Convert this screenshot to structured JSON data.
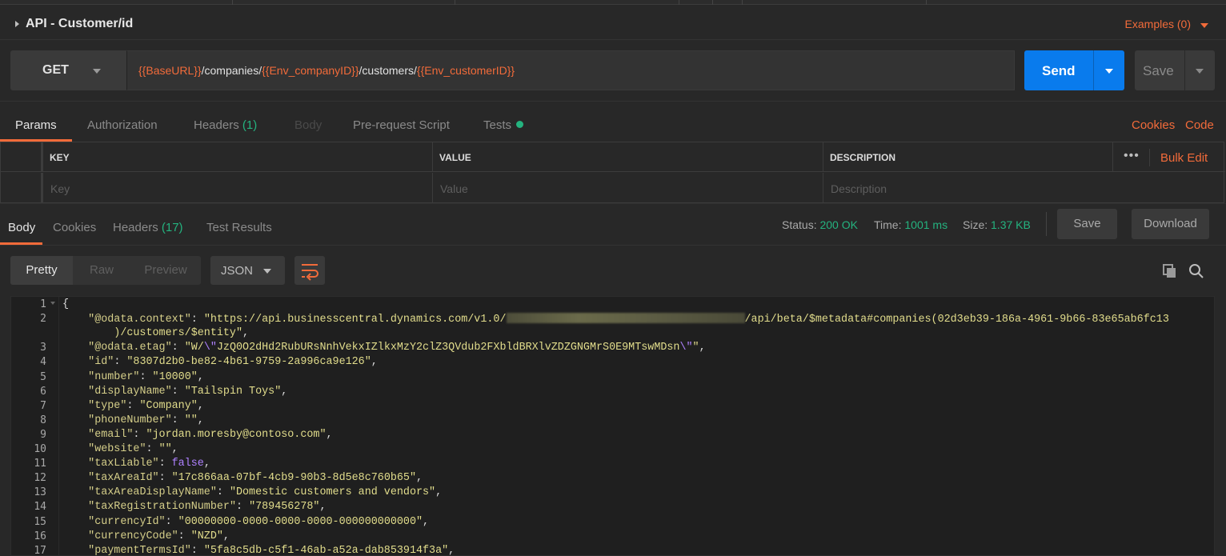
{
  "request": {
    "title": "API - Customer/id",
    "examples_label": "Examples (0)",
    "method": "GET",
    "url_parts": [
      {
        "text": "{{BaseURL}}",
        "type": "var"
      },
      {
        "text": "/companies/",
        "type": "path"
      },
      {
        "text": "{{Env_companyID}}",
        "type": "var"
      },
      {
        "text": "/customers/",
        "type": "path"
      },
      {
        "text": "{{Env_customerID}}",
        "type": "var"
      }
    ],
    "send_label": "Send",
    "save_label": "Save"
  },
  "request_tabs": {
    "params": "Params",
    "authorization": "Authorization",
    "headers": "Headers",
    "headers_count": "(1)",
    "body": "Body",
    "prerequest": "Pre-request Script",
    "tests": "Tests",
    "cookies_link": "Cookies",
    "code_link": "Code"
  },
  "params_table": {
    "headers": [
      "KEY",
      "VALUE",
      "DESCRIPTION"
    ],
    "placeholders": [
      "Key",
      "Value",
      "Description"
    ],
    "more": "•••",
    "bulk_edit": "Bulk Edit"
  },
  "response": {
    "tabs": {
      "body": "Body",
      "cookies": "Cookies",
      "headers": "Headers",
      "headers_count": "(17)",
      "test_results": "Test Results"
    },
    "status_label": "Status:",
    "status_value": "200 OK",
    "time_label": "Time:",
    "time_value": "1001 ms",
    "size_label": "Size:",
    "size_value": "1.37 KB",
    "save_label": "Save",
    "download_label": "Download",
    "view_modes": [
      "Pretty",
      "Raw",
      "Preview"
    ],
    "active_view": "Pretty",
    "format": "JSON"
  },
  "code_lines": [
    {
      "n": "1",
      "segs": [
        [
          "pun",
          "{"
        ]
      ]
    },
    {
      "n": "2",
      "segs": [
        [
          "pun",
          "    "
        ],
        [
          "key",
          "\"@odata.context\""
        ],
        [
          "pun",
          ": "
        ],
        [
          "str",
          "\"https://api.businesscentral.dynamics.com/v1.0/"
        ],
        [
          "blur",
          ""
        ],
        [
          "str",
          "/api/beta/$metadata#companies(02d3eb39-186a-4961-9b66-83e65ab6fc13"
        ]
      ]
    },
    {
      "n": "",
      "segs": [
        [
          "str",
          "        )/customers/$entity\""
        ],
        [
          "pun",
          ","
        ]
      ]
    },
    {
      "n": "3",
      "segs": [
        [
          "pun",
          "    "
        ],
        [
          "key",
          "\"@odata.etag\""
        ],
        [
          "pun",
          ": "
        ],
        [
          "str",
          "\"W/"
        ],
        [
          "esc",
          "\\\""
        ],
        [
          "str",
          "JzQ0O2dHd2RubURsNnhVekxIZlkxMzY2clZ3QVdub2FXbldBRXlvZDZGNGMrS0E9MTswMDsn"
        ],
        [
          "esc",
          "\\\""
        ],
        [
          "str",
          "\""
        ],
        [
          "pun",
          ","
        ]
      ]
    },
    {
      "n": "4",
      "segs": [
        [
          "pun",
          "    "
        ],
        [
          "key",
          "\"id\""
        ],
        [
          "pun",
          ": "
        ],
        [
          "str",
          "\"8307d2b0-be82-4b61-9759-2a996ca9e126\""
        ],
        [
          "pun",
          ","
        ]
      ]
    },
    {
      "n": "5",
      "segs": [
        [
          "pun",
          "    "
        ],
        [
          "key",
          "\"number\""
        ],
        [
          "pun",
          ": "
        ],
        [
          "str",
          "\"10000\""
        ],
        [
          "pun",
          ","
        ]
      ]
    },
    {
      "n": "6",
      "segs": [
        [
          "pun",
          "    "
        ],
        [
          "key",
          "\"displayName\""
        ],
        [
          "pun",
          ": "
        ],
        [
          "str",
          "\"Tailspin Toys\""
        ],
        [
          "pun",
          ","
        ]
      ]
    },
    {
      "n": "7",
      "segs": [
        [
          "pun",
          "    "
        ],
        [
          "key",
          "\"type\""
        ],
        [
          "pun",
          ": "
        ],
        [
          "str",
          "\"Company\""
        ],
        [
          "pun",
          ","
        ]
      ]
    },
    {
      "n": "8",
      "segs": [
        [
          "pun",
          "    "
        ],
        [
          "key",
          "\"phoneNumber\""
        ],
        [
          "pun",
          ": "
        ],
        [
          "str",
          "\"\""
        ],
        [
          "pun",
          ","
        ]
      ]
    },
    {
      "n": "9",
      "segs": [
        [
          "pun",
          "    "
        ],
        [
          "key",
          "\"email\""
        ],
        [
          "pun",
          ": "
        ],
        [
          "str",
          "\"jordan.moresby@contoso.com\""
        ],
        [
          "pun",
          ","
        ]
      ]
    },
    {
      "n": "10",
      "segs": [
        [
          "pun",
          "    "
        ],
        [
          "key",
          "\"website\""
        ],
        [
          "pun",
          ": "
        ],
        [
          "str",
          "\"\""
        ],
        [
          "pun",
          ","
        ]
      ]
    },
    {
      "n": "11",
      "segs": [
        [
          "pun",
          "    "
        ],
        [
          "key",
          "\"taxLiable\""
        ],
        [
          "pun",
          ": "
        ],
        [
          "bool",
          "false"
        ],
        [
          "pun",
          ","
        ]
      ]
    },
    {
      "n": "12",
      "segs": [
        [
          "pun",
          "    "
        ],
        [
          "key",
          "\"taxAreaId\""
        ],
        [
          "pun",
          ": "
        ],
        [
          "str",
          "\"17c866aa-07bf-4cb9-90b3-8d5e8c760b65\""
        ],
        [
          "pun",
          ","
        ]
      ]
    },
    {
      "n": "13",
      "segs": [
        [
          "pun",
          "    "
        ],
        [
          "key",
          "\"taxAreaDisplayName\""
        ],
        [
          "pun",
          ": "
        ],
        [
          "str",
          "\"Domestic customers and vendors\""
        ],
        [
          "pun",
          ","
        ]
      ]
    },
    {
      "n": "14",
      "segs": [
        [
          "pun",
          "    "
        ],
        [
          "key",
          "\"taxRegistrationNumber\""
        ],
        [
          "pun",
          ": "
        ],
        [
          "str",
          "\"789456278\""
        ],
        [
          "pun",
          ","
        ]
      ]
    },
    {
      "n": "15",
      "segs": [
        [
          "pun",
          "    "
        ],
        [
          "key",
          "\"currencyId\""
        ],
        [
          "pun",
          ": "
        ],
        [
          "str",
          "\"00000000-0000-0000-0000-000000000000\""
        ],
        [
          "pun",
          ","
        ]
      ]
    },
    {
      "n": "16",
      "segs": [
        [
          "pun",
          "    "
        ],
        [
          "key",
          "\"currencyCode\""
        ],
        [
          "pun",
          ": "
        ],
        [
          "str",
          "\"NZD\""
        ],
        [
          "pun",
          ","
        ]
      ]
    },
    {
      "n": "17",
      "segs": [
        [
          "pun",
          "    "
        ],
        [
          "key",
          "\"paymentTermsId\""
        ],
        [
          "pun",
          ": "
        ],
        [
          "str",
          "\"5fa8c5db-c5f1-46ab-a52a-dab853914f3a\""
        ],
        [
          "pun",
          ","
        ]
      ]
    }
  ],
  "colors": {
    "accent": "#f26b3a",
    "send_blue": "#097bed",
    "status_green": "#24b37f"
  }
}
